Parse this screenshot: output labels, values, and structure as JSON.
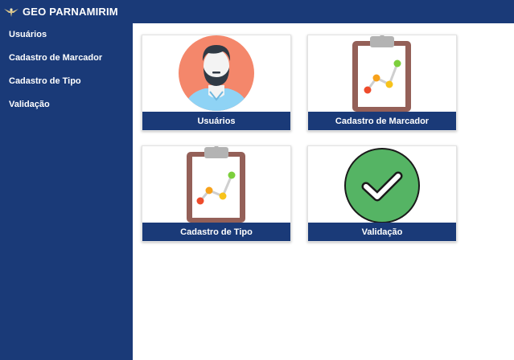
{
  "header": {
    "title": "GEO PARNAMIRIM",
    "logo_icon": "eagle-logo-icon"
  },
  "sidebar": {
    "items": [
      {
        "label": "Usuários"
      },
      {
        "label": "Cadastro de Marcador"
      },
      {
        "label": "Cadastro de Tipo"
      },
      {
        "label": "Validação"
      }
    ]
  },
  "cards": [
    {
      "label": "Usuários",
      "icon": "user-avatar-icon"
    },
    {
      "label": "Cadastro de Marcador",
      "icon": "clipboard-chart-icon"
    },
    {
      "label": "Cadastro de Tipo",
      "icon": "clipboard-chart-icon"
    },
    {
      "label": "Validação",
      "icon": "check-circle-icon"
    }
  ],
  "colors": {
    "brand": "#1a3a78",
    "avatar_bg": "#f4876b",
    "clipboard": "#946058",
    "check_bg": "#55b464"
  }
}
